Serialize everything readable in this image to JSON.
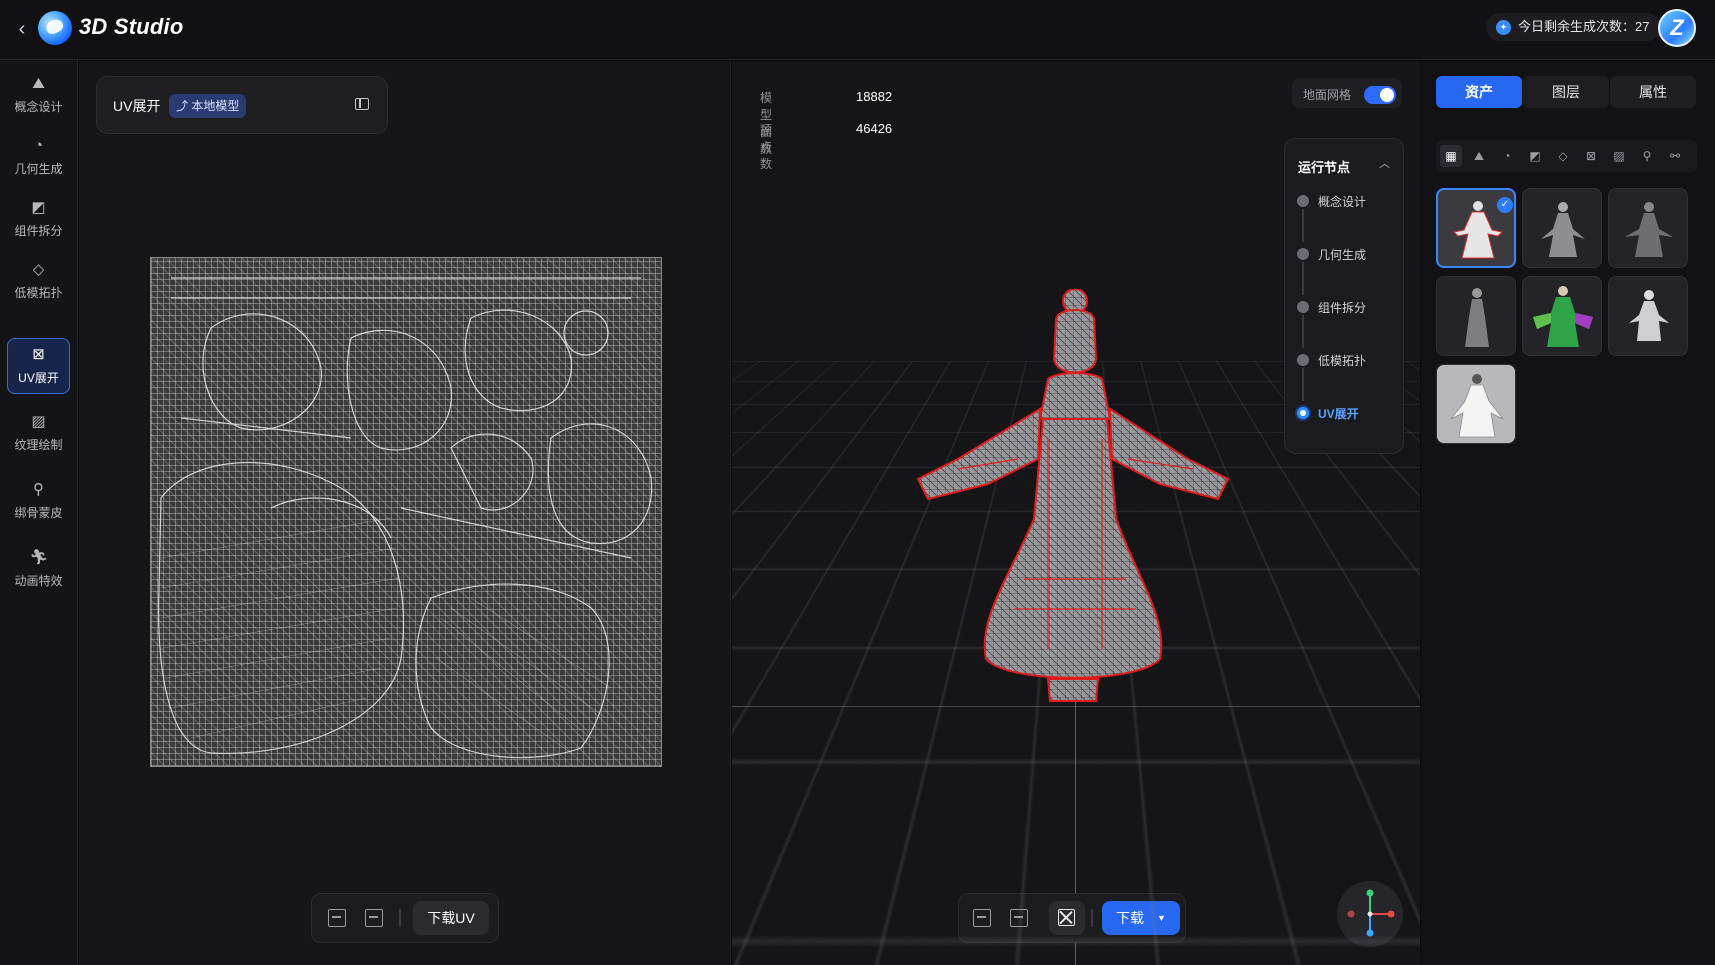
{
  "header": {
    "back_icon": "chevron-left-icon",
    "logo_icon": "3d-studio-logo",
    "app_title": "3D Studio",
    "quota_label": "今日剩余生成次数：27",
    "avatar_letter": "Z"
  },
  "sidebar": {
    "items": [
      {
        "label": "概念设计",
        "icon": "image-icon"
      },
      {
        "label": "几何生成",
        "icon": "shapes-icon"
      },
      {
        "label": "组件拆分",
        "icon": "split-icon"
      },
      {
        "label": "低模拓扑",
        "icon": "topology-icon"
      },
      {
        "label": "UV展开",
        "icon": "uv-icon"
      },
      {
        "label": "纹理绘制",
        "icon": "texture-icon"
      },
      {
        "label": "绑骨蒙皮",
        "icon": "skeleton-icon"
      },
      {
        "label": "动画特效",
        "icon": "animation-icon"
      }
    ],
    "active_index": 4
  },
  "uv_panel": {
    "title": "UV展开",
    "tag": "本地模型",
    "download_label": "下载UV"
  },
  "viewport": {
    "stats": [
      {
        "key": "模型面数",
        "value": "18882"
      },
      {
        "key": "顶点数",
        "value": "46426"
      }
    ],
    "grid_toggle_label": "地面网格",
    "grid_toggle_on": true,
    "nodes_title": "运行节点",
    "nodes": [
      "概念设计",
      "几何生成",
      "组件拆分",
      "低模拓扑",
      "UV展开"
    ],
    "active_node_index": 4,
    "download_label": "下载",
    "accent": "#2768f0"
  },
  "right_panel": {
    "tabs": [
      "资产",
      "图层",
      "属性"
    ],
    "active_tab": 0,
    "filter_icons": [
      "all-icon",
      "image-icon",
      "shapes-icon",
      "split-icon",
      "topology-icon",
      "uv-icon",
      "texture-icon",
      "skeleton-icon",
      "animation-icon"
    ],
    "assets_count": 7,
    "selected_asset": 0
  }
}
